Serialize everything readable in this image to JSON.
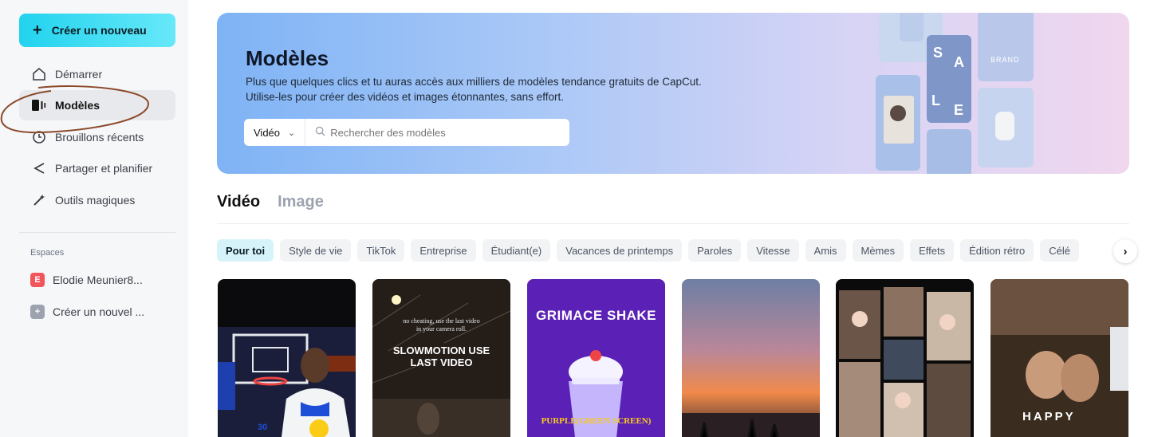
{
  "sidebar": {
    "create_button": "Créer un nouveau",
    "items": [
      {
        "label": "Démarrer",
        "icon": "home-icon"
      },
      {
        "label": "Modèles",
        "icon": "templates-icon",
        "active": true
      },
      {
        "label": "Brouillons récents",
        "icon": "clock-icon"
      },
      {
        "label": "Partager et planifier",
        "icon": "share-icon"
      },
      {
        "label": "Outils magiques",
        "icon": "magic-wand-icon"
      }
    ],
    "spaces_label": "Espaces",
    "spaces": [
      {
        "badge": "E",
        "label": "Elodie Meunier8...",
        "color": "#f2545b"
      },
      {
        "badge": "+",
        "label": "Créer un nouvel ...",
        "color": "#9ca3af"
      }
    ]
  },
  "hero": {
    "title": "Modèles",
    "subtitle_line1": "Plus que quelques clics et tu auras accès aux milliers de modèles tendance gratuits de CapCut.",
    "subtitle_line2": "Utilise-les pour créer des vidéos et images étonnantes, sans effort.",
    "search_type": "Vidéo",
    "search_placeholder": "Rechercher des modèles",
    "deco_letters": [
      "S",
      "A",
      "L",
      "E"
    ],
    "deco_text": "BRAND"
  },
  "tabs": [
    "Vidéo",
    "Image"
  ],
  "chips": [
    "Pour toi",
    "Style de vie",
    "TikTok",
    "Entreprise",
    "Étudiant(e)",
    "Vacances de printemps",
    "Paroles",
    "Vitesse",
    "Amis",
    "Mèmes",
    "Effets",
    "Édition rétro",
    "Célé"
  ],
  "thumbnails": [
    {
      "name": "basketball",
      "overlay": "",
      "jersey": "30"
    },
    {
      "name": "slowmotion",
      "small_text": "no cheating, use the last video in your camera roll.",
      "overlay": "SLOWMOTION USE LAST VIDEO"
    },
    {
      "name": "grimace",
      "overlay": "GRIMACE SHAKE",
      "bottom_text": "PURPLE(GREEN SCREEN)"
    },
    {
      "name": "sunset",
      "overlay": ""
    },
    {
      "name": "collage",
      "overlay": ""
    },
    {
      "name": "happy",
      "overlay": "HAPPY"
    }
  ],
  "colors": {
    "accent": "#22d3ee",
    "active_chip": "#d7f3fa",
    "annotation": "#8b4a2b"
  }
}
